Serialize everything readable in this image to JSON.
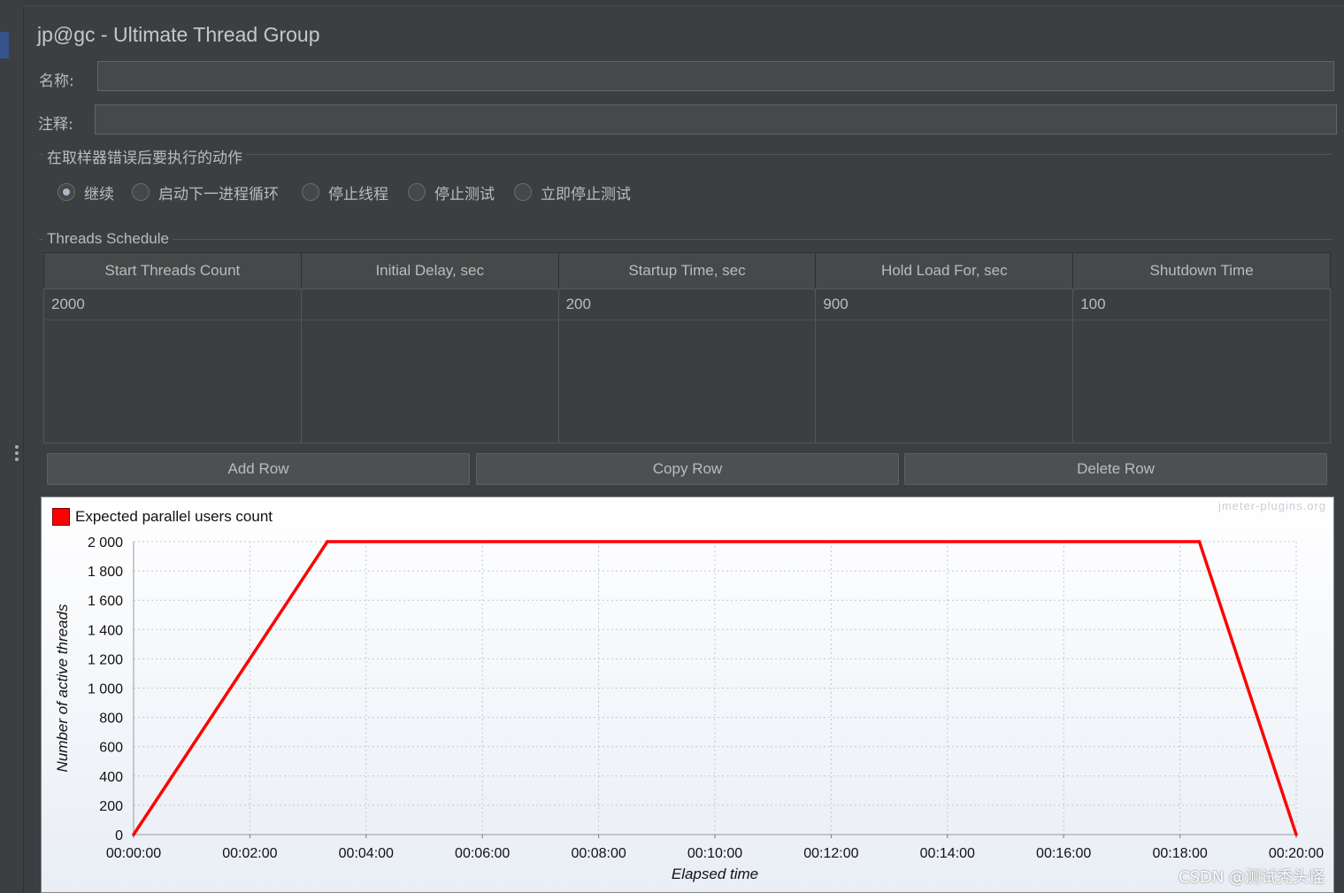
{
  "window": {
    "title": "jp@gc - Ultimate Thread Group"
  },
  "form": {
    "name_label": "名称:",
    "name_value": "",
    "comment_label": "注释:",
    "comment_value": ""
  },
  "error_action": {
    "title": "在取样器错误后要执行的动作",
    "options": [
      {
        "label": "继续",
        "selected": true
      },
      {
        "label": "启动下一进程循环",
        "selected": false
      },
      {
        "label": "停止线程",
        "selected": false
      },
      {
        "label": "停止测试",
        "selected": false
      },
      {
        "label": "立即停止测试",
        "selected": false
      }
    ]
  },
  "schedule": {
    "title": "Threads Schedule",
    "columns": [
      "Start Threads Count",
      "Initial Delay, sec",
      "Startup Time, sec",
      "Hold Load For, sec",
      "Shutdown Time"
    ],
    "rows": [
      [
        "2000",
        "",
        "200",
        "900",
        "100"
      ]
    ]
  },
  "buttons": {
    "add_row": "Add Row",
    "copy_row": "Copy Row",
    "delete_row": "Delete Row"
  },
  "chart_data": {
    "type": "line",
    "watermark": "jmeter-plugins.org",
    "xlabel": "Elapsed time",
    "ylabel": "Number of active threads",
    "xlim": [
      0,
      1200
    ],
    "ylim": [
      0,
      2000
    ],
    "x_ticks": [
      "00:00:00",
      "00:02:00",
      "00:04:00",
      "00:06:00",
      "00:08:00",
      "00:10:00",
      "00:12:00",
      "00:14:00",
      "00:16:00",
      "00:18:00",
      "00:20:00"
    ],
    "y_ticks": [
      "0",
      "200",
      "400",
      "600",
      "800",
      "1 000",
      "1 200",
      "1 400",
      "1 600",
      "1 800",
      "2 000"
    ],
    "grid": true,
    "legend": "top-left",
    "series": [
      {
        "name": "Expected parallel users count",
        "color": "#ff0000",
        "x": [
          0,
          200,
          1100,
          1200
        ],
        "y": [
          0,
          2000,
          2000,
          0
        ]
      }
    ]
  },
  "overlay": {
    "watermark_text": "CSDN @测试秃头怪"
  }
}
